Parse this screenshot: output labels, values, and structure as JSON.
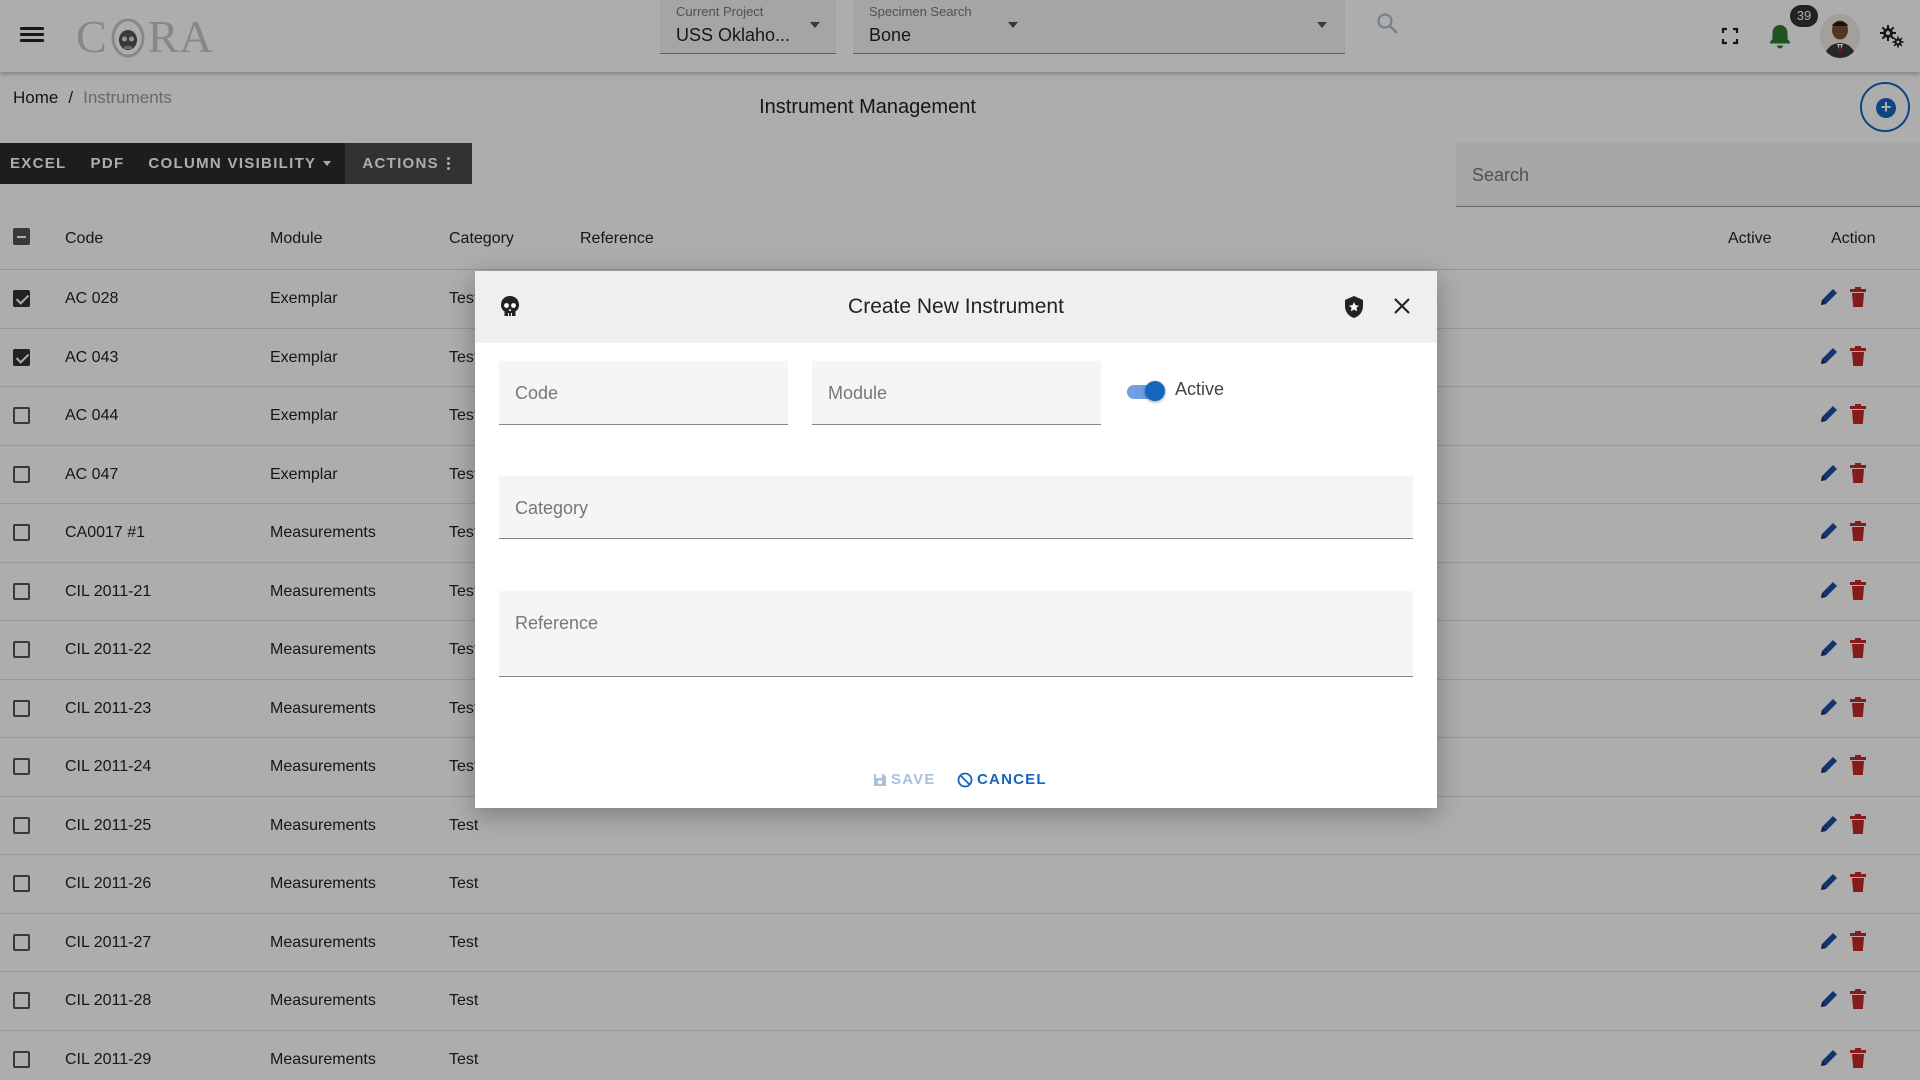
{
  "app": {
    "logo_text_left": "C",
    "logo_text_right": "RA"
  },
  "topbar": {
    "project": {
      "label": "Current Project",
      "value": "USS Oklaho..."
    },
    "specimen": {
      "label": "Specimen Search",
      "value": "Bone"
    },
    "notifications_count": "39"
  },
  "breadcrumb": {
    "home": "Home",
    "separator": "/",
    "current": "Instruments"
  },
  "page": {
    "title": "Instrument Management"
  },
  "toolbar": {
    "excel": "EXCEL",
    "pdf": "PDF",
    "column_visibility": "COLUMN VISIBILITY",
    "actions": "ACTIONS"
  },
  "table_search": {
    "placeholder": "Search"
  },
  "table": {
    "headers": {
      "code": "Code",
      "module": "Module",
      "category": "Category",
      "reference": "Reference",
      "active": "Active",
      "action": "Action"
    },
    "rows": [
      {
        "checked": true,
        "code": "AC 028",
        "module": "Exemplar",
        "category": "Test"
      },
      {
        "checked": true,
        "code": "AC 043",
        "module": "Exemplar",
        "category": "Test"
      },
      {
        "checked": false,
        "code": "AC 044",
        "module": "Exemplar",
        "category": "Test"
      },
      {
        "checked": false,
        "code": "AC 047",
        "module": "Exemplar",
        "category": "Test"
      },
      {
        "checked": false,
        "code": "CA0017 #1",
        "module": "Measurements",
        "category": "Test"
      },
      {
        "checked": false,
        "code": "CIL 2011-21",
        "module": "Measurements",
        "category": "Test"
      },
      {
        "checked": false,
        "code": "CIL 2011-22",
        "module": "Measurements",
        "category": "Test"
      },
      {
        "checked": false,
        "code": "CIL 2011-23",
        "module": "Measurements",
        "category": "Test"
      },
      {
        "checked": false,
        "code": "CIL 2011-24",
        "module": "Measurements",
        "category": "Test"
      },
      {
        "checked": false,
        "code": "CIL 2011-25",
        "module": "Measurements",
        "category": "Test"
      },
      {
        "checked": false,
        "code": "CIL 2011-26",
        "module": "Measurements",
        "category": "Test"
      },
      {
        "checked": false,
        "code": "CIL 2011-27",
        "module": "Measurements",
        "category": "Test"
      },
      {
        "checked": false,
        "code": "CIL 2011-28",
        "module": "Measurements",
        "category": "Test"
      },
      {
        "checked": false,
        "code": "CIL 2011-29",
        "module": "Measurements",
        "category": "Test"
      }
    ]
  },
  "modal": {
    "title": "Create New Instrument",
    "code_placeholder": "Code",
    "module_placeholder": "Module",
    "active_label": "Active",
    "active_on": true,
    "category_placeholder": "Category",
    "reference_placeholder": "Reference",
    "save_label": "SAVE",
    "cancel_label": "CANCEL"
  },
  "colors": {
    "accent": "#1565c0",
    "delete": "#c62828",
    "notification": "#2e7d32",
    "toolbar": "#2b2b2b"
  },
  "icons": {
    "menu": "hamburger-icon",
    "search": "search-icon",
    "fullscreen": "fullscreen-icon",
    "notifications": "bell-icon",
    "settings": "gears-icon",
    "add": "plus-circle-icon",
    "edit": "pencil-icon",
    "delete": "trash-icon",
    "modal_logo": "skull-icon",
    "modal_shield": "shield-icon",
    "close": "close-icon"
  }
}
